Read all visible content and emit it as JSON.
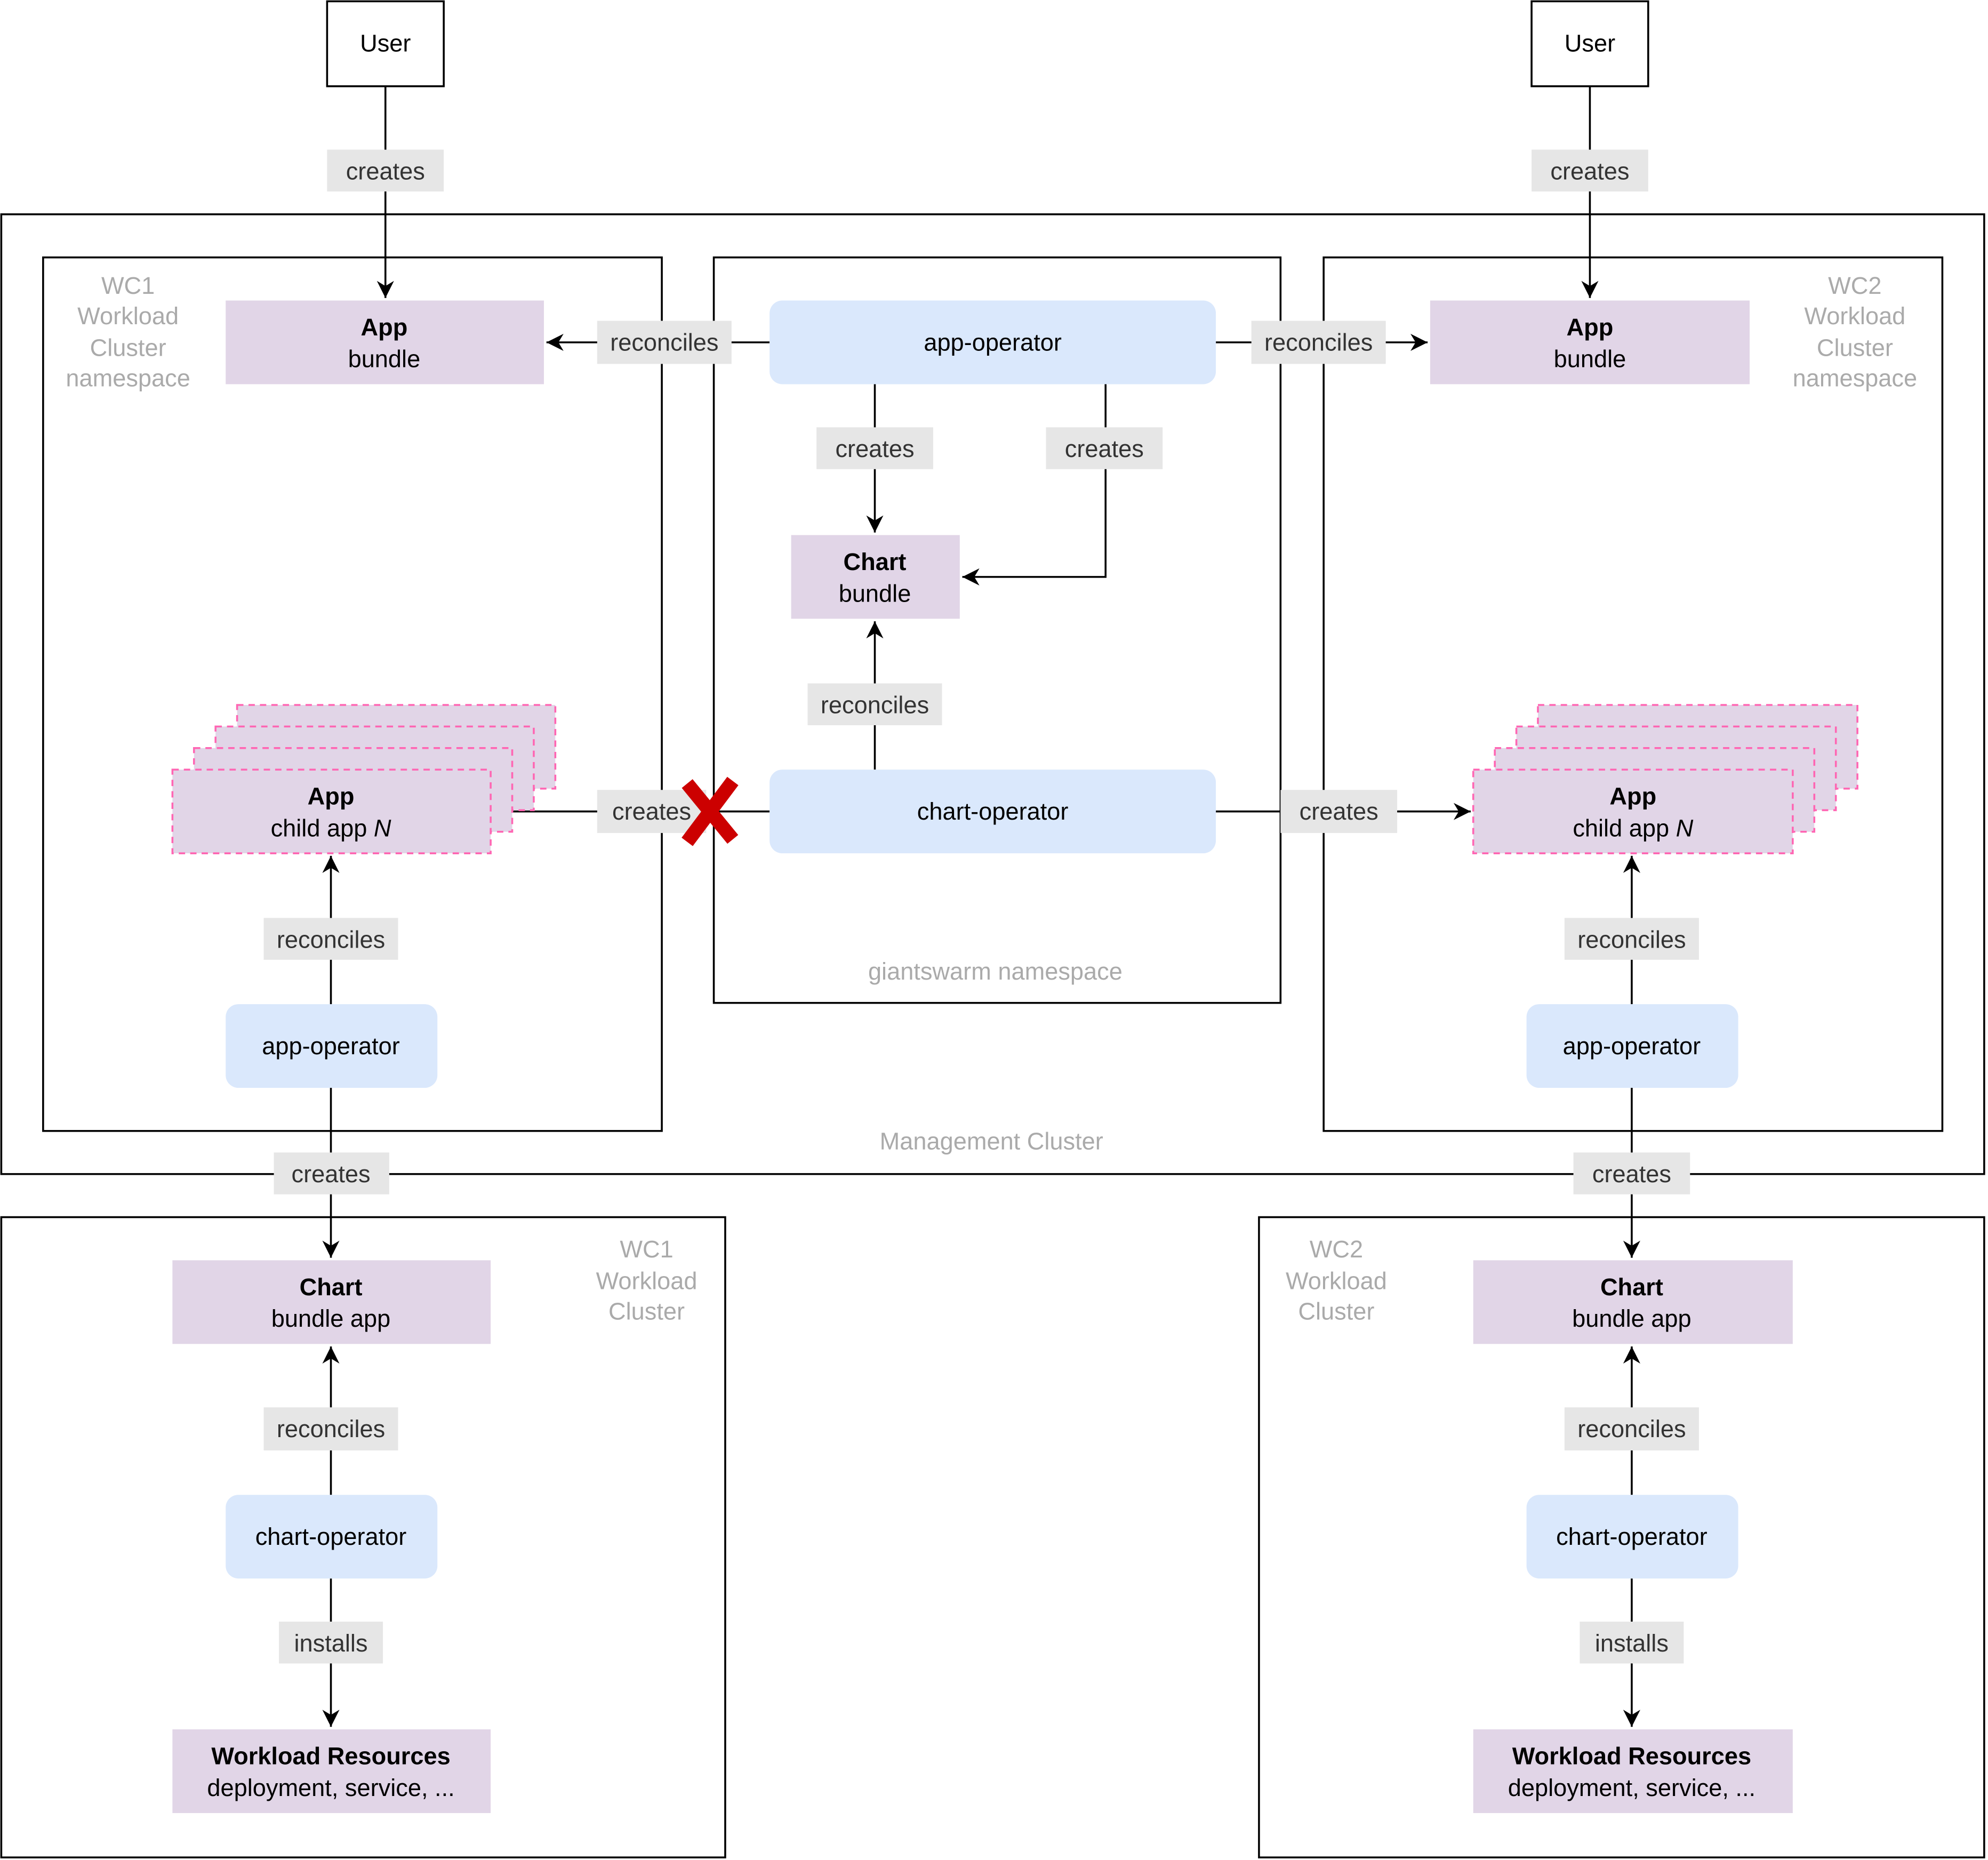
{
  "colors": {
    "resource": "#e1d5e7",
    "operator": "#dae8fc",
    "edge_label_bg": "#e6e6e6",
    "child_app_border": "#ff66b3",
    "blocked_mark": "#cc0000",
    "container_label": "#aaaaaa"
  },
  "containers": {
    "management": "Management Cluster",
    "giantswarm": "giantswarm namespace",
    "wc1_namespace": [
      "WC1",
      "Workload",
      "Cluster",
      "namespace"
    ],
    "wc2_namespace": [
      "WC2",
      "Workload",
      "Cluster",
      "namespace"
    ],
    "wc1_cluster": [
      "WC1",
      "Workload",
      "Cluster"
    ],
    "wc2_cluster": [
      "WC2",
      "Workload",
      "Cluster"
    ]
  },
  "nodes": {
    "user": "User",
    "app_bundle": {
      "title": "App",
      "sub": "bundle"
    },
    "app_operator": "app-operator",
    "chart_operator": "chart-operator",
    "chart_bundle": {
      "title": "Chart",
      "sub": "bundle"
    },
    "child_app": {
      "title": "App",
      "sub": "child app ",
      "sub_italic": "N"
    },
    "chart_bundle_app": {
      "title": "Chart",
      "sub": "bundle app"
    },
    "workload_resources": {
      "title": "Workload Resources",
      "sub": "deployment, service, ..."
    }
  },
  "edges": {
    "creates": "creates",
    "reconciles": "reconciles",
    "installs": "installs"
  },
  "blocked_icon": "red-x-icon"
}
